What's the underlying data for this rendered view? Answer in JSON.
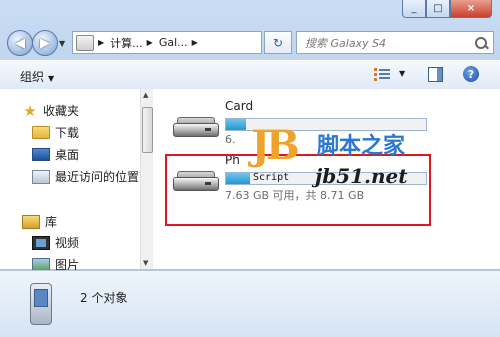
{
  "address": {
    "segments": [
      "计算...",
      "Gal..."
    ],
    "search_placeholder": "搜索 Galaxy S4"
  },
  "toolbar": {
    "organize_label": "组织"
  },
  "nav": {
    "items": [
      {
        "label": "收藏夹",
        "icon": "star-icon"
      },
      {
        "label": "下载",
        "icon": "folder-icon"
      },
      {
        "label": "桌面",
        "icon": "desktop-icon"
      },
      {
        "label": "最近访问的位置",
        "icon": "recent-places-icon"
      },
      {
        "label": "库",
        "icon": "library-icon"
      },
      {
        "label": "视频",
        "icon": "video-icon"
      },
      {
        "label": "图片",
        "icon": "picture-icon"
      }
    ]
  },
  "drives": [
    {
      "name": "Card",
      "size_text": "6.",
      "fill": 0.1
    },
    {
      "name": "Ph",
      "size_text": "7.63 GB 可用，共 8.71 GB",
      "fill": 0.12
    }
  ],
  "watermark": {
    "logo": "JB",
    "script": "Script",
    "cn_text": "脚本之家",
    "url": "jb51.net"
  },
  "status": {
    "count_text": "2 个对象"
  },
  "colors": {
    "highlight": "#e0181e",
    "progress": "#2596cf"
  }
}
